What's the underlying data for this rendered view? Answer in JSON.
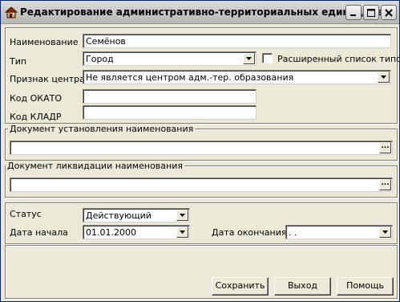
{
  "window": {
    "title": "Редактирование административно-территориальных единиц (на..."
  },
  "form": {
    "name_label": "Наименование",
    "name_value": "Семёнов",
    "type_label": "Тип",
    "type_value": "Город",
    "extended_types_label": "Расширенный список типов",
    "extended_types_checked": false,
    "center_label": "Признак центра",
    "center_value": "Не является центром адм.-тер. образования",
    "okato_label": "Код ОКАТО",
    "okato_value": "",
    "kladr_label": "Код КЛАДР",
    "kladr_value": ""
  },
  "doc_establish": {
    "legend": "Документ установления наименования",
    "value": "",
    "button": "..."
  },
  "doc_liquidation": {
    "legend": "Документ ликвидации наименования",
    "value": "",
    "button": "..."
  },
  "status": {
    "status_label": "Статус",
    "status_value": "Действующий",
    "start_label": "Дата начала",
    "start_value": "01.01.2000",
    "end_label": "Дата окончания",
    "end_value": " . ."
  },
  "buttons": {
    "save": "Сохранить",
    "exit": "Выход",
    "help": "Помощь"
  }
}
